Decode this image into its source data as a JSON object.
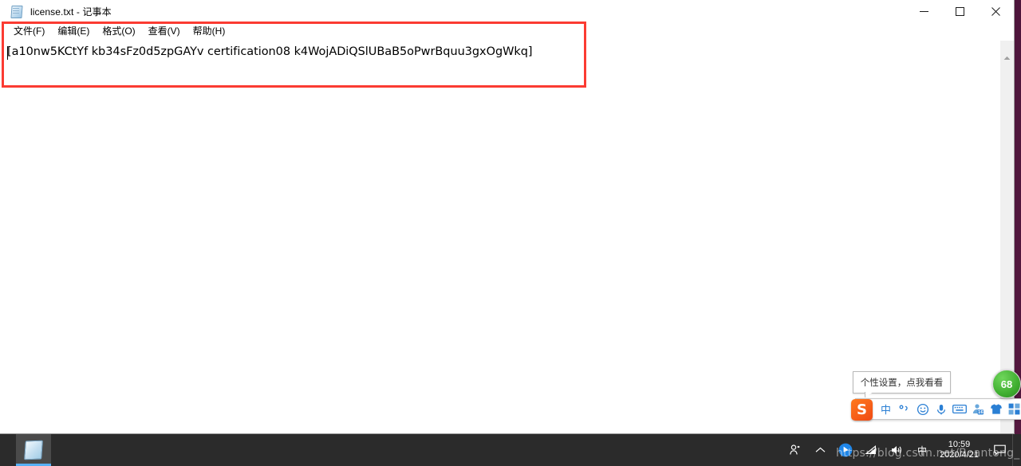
{
  "window": {
    "title": "license.txt - 记事本",
    "app_icon": "notepad-icon",
    "controls": {
      "minimize_label": "最小化",
      "maximize_label": "最大化",
      "close_label": "关闭"
    }
  },
  "menubar": {
    "items": [
      {
        "label": "文件(F)",
        "name": "menu-file"
      },
      {
        "label": "编辑(E)",
        "name": "menu-edit"
      },
      {
        "label": "格式(O)",
        "name": "menu-format"
      },
      {
        "label": "查看(V)",
        "name": "menu-view"
      },
      {
        "label": "帮助(H)",
        "name": "menu-help"
      }
    ]
  },
  "document": {
    "text": "[a10nw5KCtYf kb34sFz0d5zpGAYv certification08 k4WojADiQSlUBaB5oPwrBquu3gxOgWkq]",
    "placeholder": ""
  },
  "annotation": {
    "shape": "rectangle",
    "color": "#fb3b32"
  },
  "ime": {
    "tooltip": "个性设置，点我看看",
    "logo": "S",
    "items": [
      {
        "label": "中",
        "name": "ime-chinese-mode-icon"
      },
      {
        "label": "°,",
        "name": "ime-punctuation-icon"
      },
      {
        "label": "☺",
        "name": "ime-emoji-icon"
      },
      {
        "label": "🎤",
        "name": "ime-voice-icon"
      },
      {
        "label": "⌨",
        "name": "ime-softkeyboard-icon"
      },
      {
        "label": "16",
        "name": "ime-user-icon"
      },
      {
        "label": "👕",
        "name": "ime-skin-icon"
      },
      {
        "label": "▦",
        "name": "ime-toolbox-icon"
      }
    ]
  },
  "floating_badge": {
    "value": "68",
    "color": "#3fae30"
  },
  "taskbar": {
    "apps": [
      {
        "label": "记事本",
        "name": "taskbar-notepad"
      }
    ],
    "tray": {
      "people_icon": "people-icon",
      "chevron_icon": "show-hidden-icons-icon",
      "onedrive_icon": "onedrive-icon",
      "network_icon": "network-icon",
      "volume_icon": "volume-icon",
      "ime_indicator": "中",
      "action_center_icon": "action-center-icon"
    },
    "clock": {
      "time": "10:59",
      "date": "2020/4/21"
    }
  },
  "watermark": {
    "text": "https://blog.csdn.net/Boantong_"
  }
}
